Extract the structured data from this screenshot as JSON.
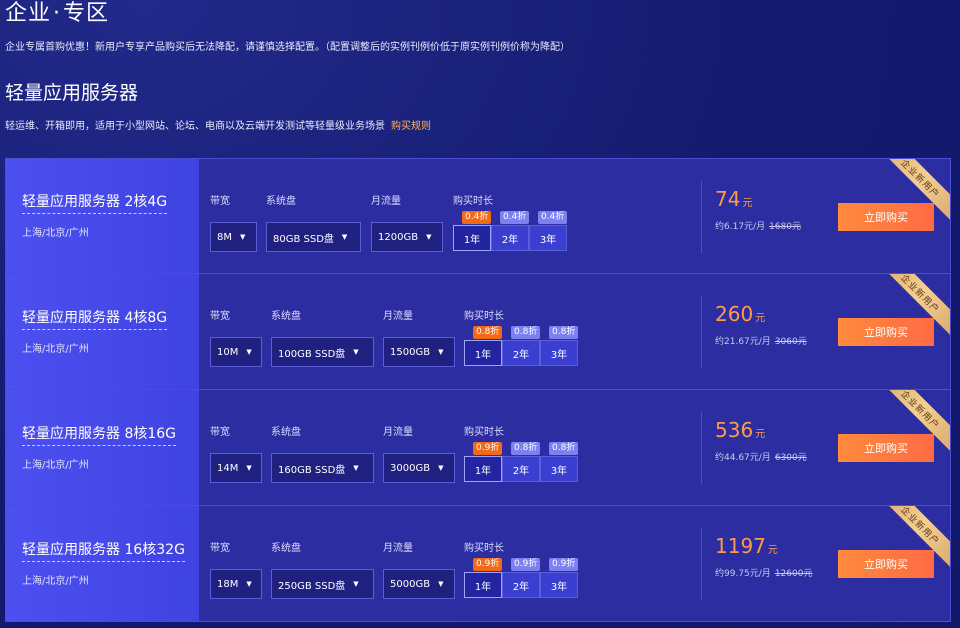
{
  "header": {
    "zone_title_a": "企业",
    "zone_title_dot": "·",
    "zone_title_b": "专区",
    "zone_desc": "企业专属首购优惠！新用户专享产品购买后无法降配，请谨慎选择配置。（配置调整后的实例刊例价低于原实例刊例价称为降配）",
    "section_title": "轻量应用服务器",
    "section_desc": "轻运维、开箱即用，适用于小型网站、论坛、电商以及云端开发测试等轻量级业务场景",
    "rule_link": "购买规则"
  },
  "labels": {
    "bandwidth": "带宽",
    "disk": "系统盘",
    "traffic": "月流量",
    "duration": "购买时长",
    "buy": "立即购买",
    "ribbon": "企业新用户",
    "price_unit": "元",
    "caret": "▼"
  },
  "cards": [
    {
      "name": "轻量应用服务器 2核4G",
      "region": "上海/北京/广州",
      "bandwidth": "8M",
      "disk": "80GB SSD盘",
      "traffic": "1200GB",
      "durations": [
        {
          "label": "1年",
          "discount": "0.4折"
        },
        {
          "label": "2年",
          "discount": "0.4折"
        },
        {
          "label": "3年",
          "discount": "0.4折"
        }
      ],
      "price": "74",
      "monthly": "约6.17元/月",
      "original": "1680元"
    },
    {
      "name": "轻量应用服务器 4核8G",
      "region": "上海/北京/广州",
      "bandwidth": "10M",
      "disk": "100GB SSD盘",
      "traffic": "1500GB",
      "durations": [
        {
          "label": "1年",
          "discount": "0.8折"
        },
        {
          "label": "2年",
          "discount": "0.8折"
        },
        {
          "label": "3年",
          "discount": "0.8折"
        }
      ],
      "price": "260",
      "monthly": "约21.67元/月",
      "original": "3060元"
    },
    {
      "name": "轻量应用服务器 8核16G",
      "region": "上海/北京/广州",
      "bandwidth": "14M",
      "disk": "160GB SSD盘",
      "traffic": "3000GB",
      "durations": [
        {
          "label": "1年",
          "discount": "0.9折"
        },
        {
          "label": "2年",
          "discount": "0.8折"
        },
        {
          "label": "3年",
          "discount": "0.8折"
        }
      ],
      "price": "536",
      "monthly": "约44.67元/月",
      "original": "6300元"
    },
    {
      "name": "轻量应用服务器 16核32G",
      "region": "上海/北京/广州",
      "bandwidth": "18M",
      "disk": "250GB SSD盘",
      "traffic": "5000GB",
      "durations": [
        {
          "label": "1年",
          "discount": "0.9折"
        },
        {
          "label": "2年",
          "discount": "0.9折"
        },
        {
          "label": "3年",
          "discount": "0.9折"
        }
      ],
      "price": "1197",
      "monthly": "约99.75元/月",
      "original": "12600元"
    }
  ]
}
